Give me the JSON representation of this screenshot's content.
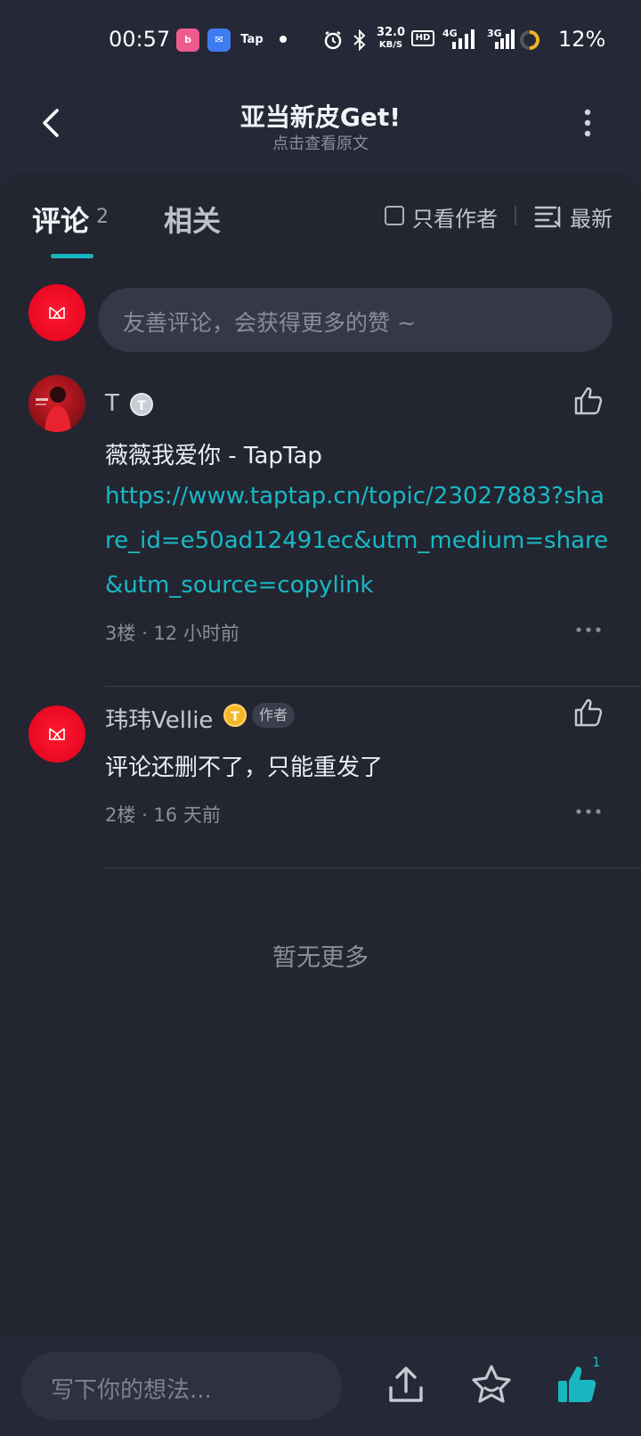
{
  "status_bar": {
    "time": "00:57",
    "speed": "32.0",
    "speed_unit": "KB/S",
    "network_1": "4G",
    "network_2": "3G",
    "battery": "12%",
    "apps": [
      "bili-icon",
      "mail-icon",
      "Tap"
    ]
  },
  "header": {
    "title": "亚当新皮Get!",
    "subtitle": "点击查看原文"
  },
  "tabs": {
    "comments_label": "评论",
    "comments_count": "2",
    "related_label": "相关",
    "only_author": "只看作者",
    "sort": "最新"
  },
  "composer": {
    "placeholder": "友善评论，会获得更多的赞 ~"
  },
  "comments": [
    {
      "user": "T",
      "level_badge": "T",
      "text": "薇薇我爱你 - TapTap",
      "link": "https://www.taptap.cn/topic/23027883?share_id=e50ad12491ec&utm_medium=share&utm_source=copylink",
      "floor": "3楼",
      "time": "12 小时前"
    },
    {
      "user": "玮玮Vellie",
      "level_badge": "T",
      "author_tag": "作者",
      "text": "评论还删不了，只能重发了",
      "floor": "2楼",
      "time": "16 天前"
    }
  ],
  "footer_text": "暂无更多",
  "bottom_bar": {
    "write_placeholder": "写下你的想法...",
    "like_count": "1"
  },
  "colors": {
    "accent": "#19b6c2",
    "background": "#252836",
    "link": "#17b9c5",
    "avatar_red": "#ff1a2e"
  }
}
